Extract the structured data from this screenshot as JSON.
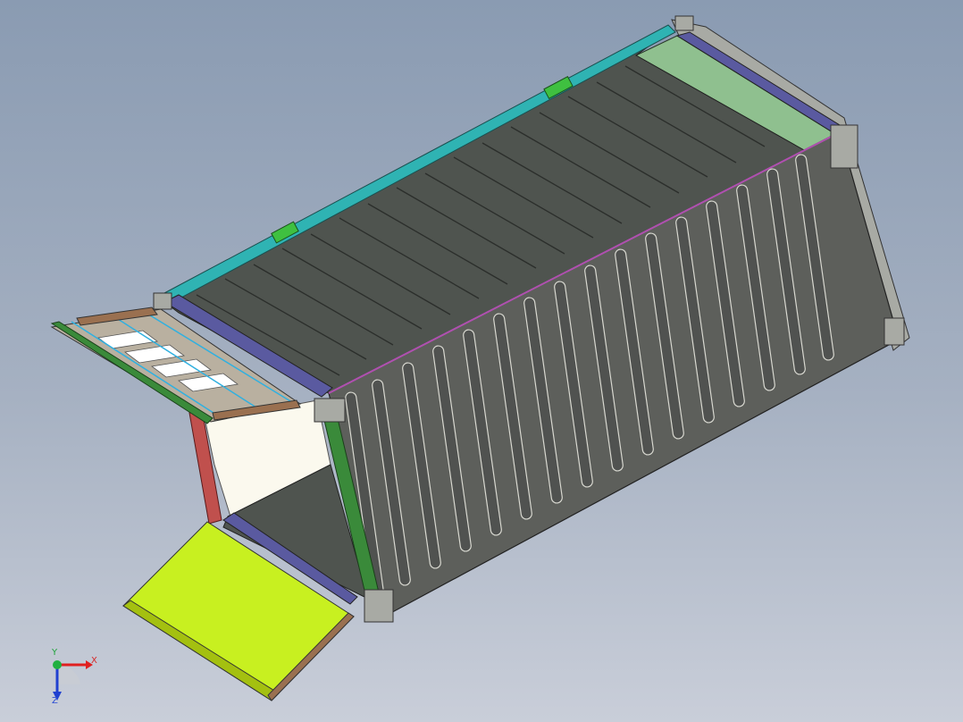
{
  "viewport": {
    "background_top": "#8a9bb2",
    "background_bottom": "#c9ced9"
  },
  "model": {
    "container_body_color": "#5d5f5b",
    "roof_panel_color": "#4f544f",
    "top_rail_color": "#2fb3b3",
    "floor_end_color": "#5a5aa0",
    "light_green_panel_color": "#8fc08f",
    "end_frame_color": "#a8aaa4",
    "open_door_color": "#c8f020",
    "side_flap_color": "#b9b0a0",
    "red_post_color": "#c0504d",
    "inner_wall_color": "#fbf9ee"
  },
  "triad": {
    "x_label": "X",
    "y_label": "Y",
    "z_label": "Z",
    "x_color": "#e02020",
    "y_color": "#20b040",
    "z_color": "#2040d0"
  }
}
